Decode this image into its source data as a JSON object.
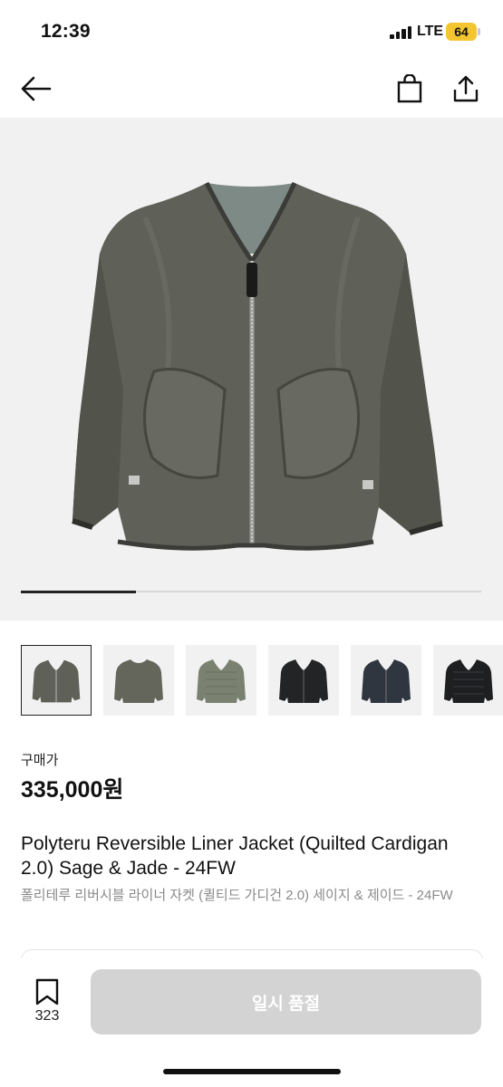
{
  "status": {
    "time": "12:39",
    "network": "LTE",
    "battery": "64"
  },
  "header": {
    "back_icon": "arrow-left-icon",
    "cart_icon": "shopping-bag-icon",
    "share_icon": "share-icon"
  },
  "gallery": {
    "progress_fraction": 0.25,
    "thumbnail_count": 6,
    "selected_index": 0
  },
  "product": {
    "price_label": "구매가",
    "price": "335,000원",
    "title_en": "Polyteru Reversible Liner Jacket (Quilted Cardigan 2.0) Sage & Jade - 24FW",
    "title_ko": "폴리테루 리버시블 라이너 자켓 (퀼티드 가디건 2.0) 세이지 & 제이드 - 24FW"
  },
  "bottom": {
    "bookmark_count": "323",
    "action_label": "일시 품절",
    "bookmark_icon": "bookmark-icon"
  },
  "colors": {
    "accent_disabled": "#d3d3d3",
    "jacket_gray": "#5f6158",
    "jacket_olive": "#7b8170",
    "jacket_black": "#222426",
    "jacket_navy": "#2f3640"
  }
}
